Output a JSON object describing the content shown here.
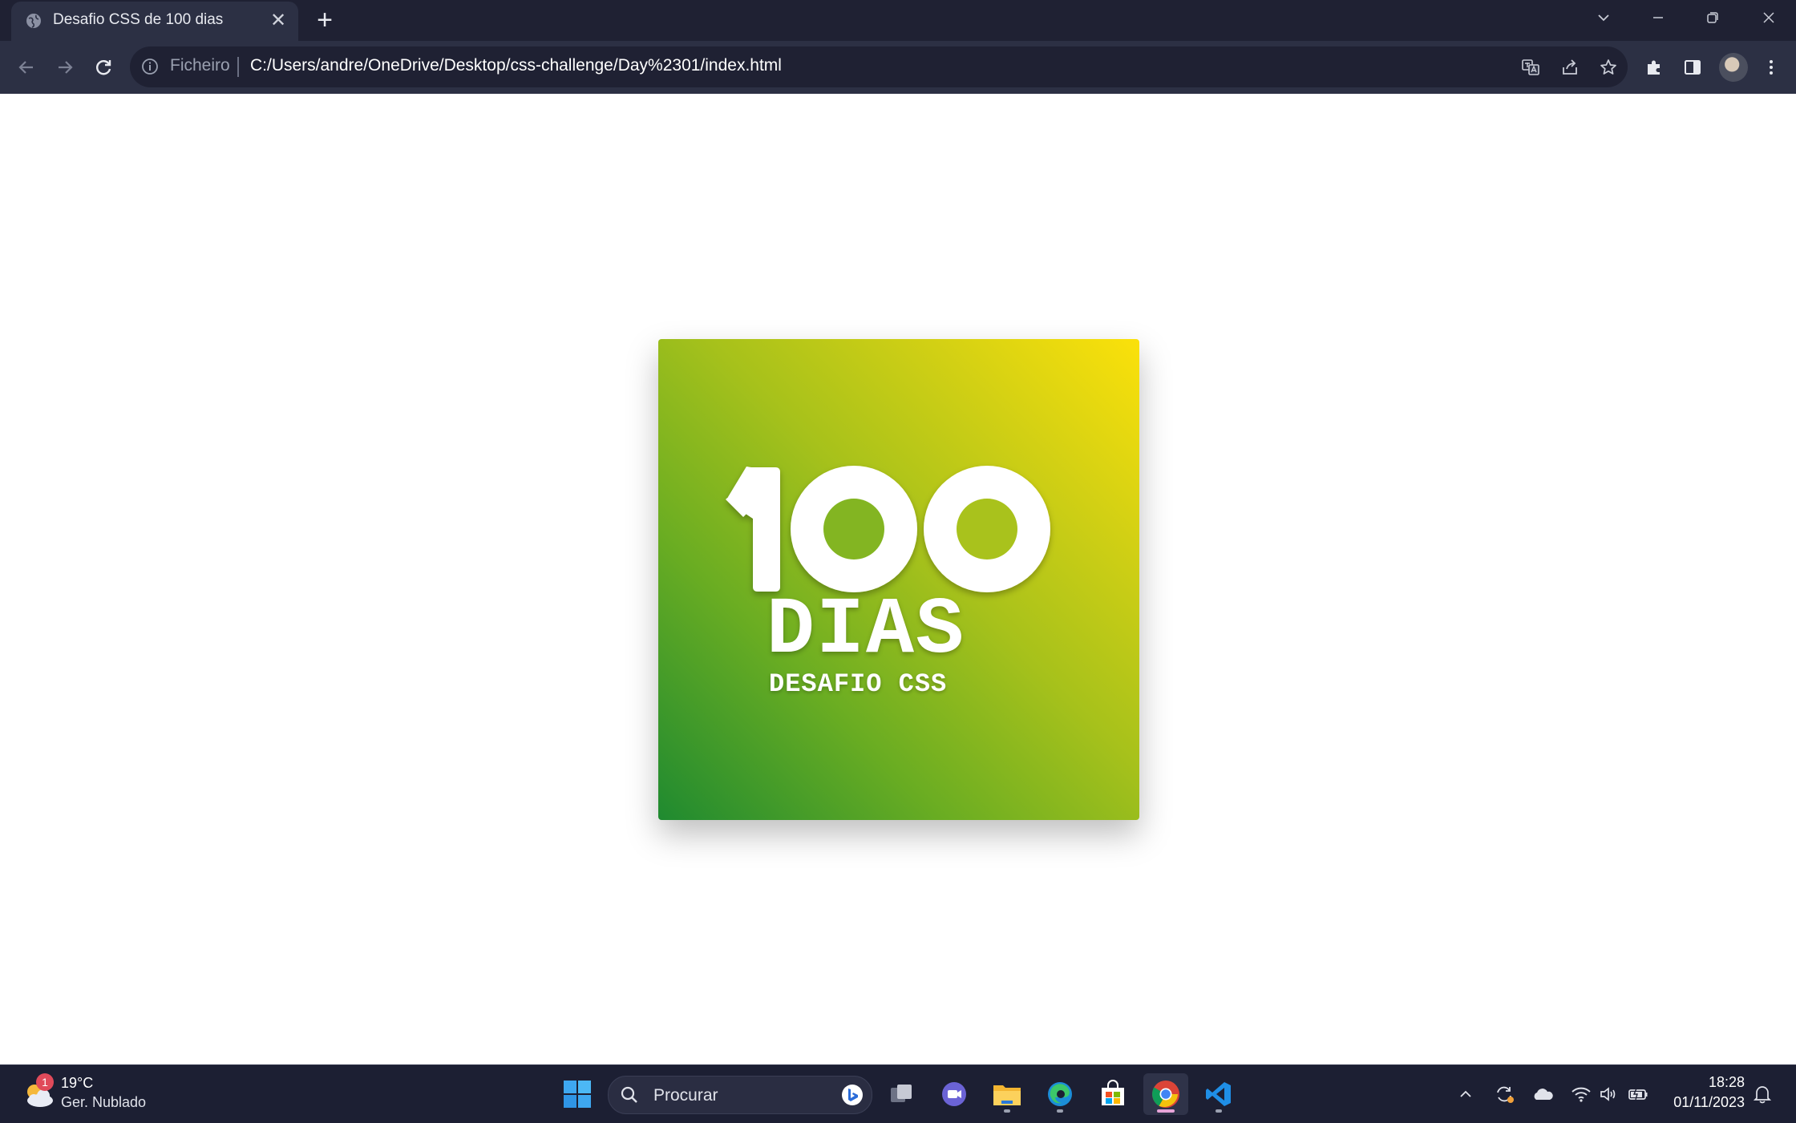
{
  "browser": {
    "tab_title": "Desafio CSS de 100 dias",
    "scheme_label": "Ficheiro",
    "url": "C:/Users/andre/OneDrive/Desktop/css-challenge/Day%2301/index.html"
  },
  "page": {
    "logo_number": "100",
    "logo_word": "DIAS",
    "logo_subtitle": "DESAFIO CSS",
    "gradient_colors": [
      "#1f8a30",
      "#6aad22",
      "#d2d014",
      "#fbe10a"
    ]
  },
  "taskbar": {
    "weather": {
      "temp": "19°C",
      "desc": "Ger. Nublado",
      "badge": "1"
    },
    "search_placeholder": "Procurar",
    "apps": [
      "start-icon",
      "search-box",
      "task-view-icon",
      "teams-icon",
      "file-explorer-icon",
      "edge-icon",
      "store-icon",
      "chrome-icon",
      "vscode-icon"
    ],
    "clock": {
      "time": "18:28",
      "date": "01/11/2023"
    }
  },
  "colors": {
    "chrome_dark": "#1f2133",
    "chrome_toolbar": "#2c3044",
    "taskbar": "#1c1f33"
  }
}
